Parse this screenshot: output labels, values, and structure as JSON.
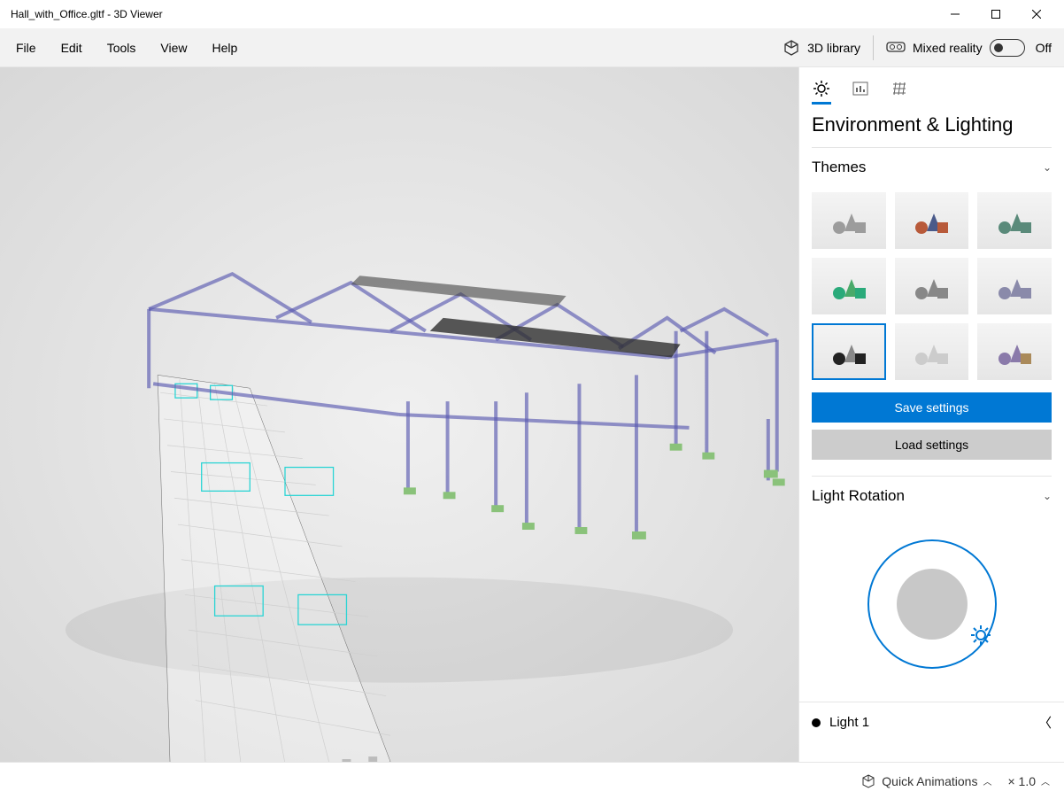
{
  "title": "Hall_with_Office.gltf - 3D Viewer",
  "menu": [
    "File",
    "Edit",
    "Tools",
    "View",
    "Help"
  ],
  "library_label": "3D library",
  "mixed_reality_label": "Mixed reality",
  "mixed_reality_state": "Off",
  "panel": {
    "title": "Environment & Lighting",
    "themes_label": "Themes",
    "save_label": "Save settings",
    "load_label": "Load settings",
    "light_rotation_label": "Light Rotation",
    "light1_label": "Light 1",
    "themes": [
      {
        "sphere": "#9c9c9c",
        "cone": "#9c9c9c",
        "cube": "#9c9c9c",
        "selected": false
      },
      {
        "sphere": "#b85a3a",
        "cone": "#4a5a8a",
        "cube": "#b85a3a",
        "selected": false
      },
      {
        "sphere": "#5a8a7a",
        "cone": "#5a8a7a",
        "cube": "#5a8a7a",
        "selected": false
      },
      {
        "sphere": "#2aaa7a",
        "cone": "#4aaa6a",
        "cube": "#2aaa7a",
        "selected": false
      },
      {
        "sphere": "#888888",
        "cone": "#888888",
        "cube": "#888888",
        "selected": false
      },
      {
        "sphere": "#8a8aaa",
        "cone": "#8a8aaa",
        "cube": "#8a8aaa",
        "selected": false
      },
      {
        "sphere": "#222222",
        "cone": "#888888",
        "cube": "#222222",
        "selected": true
      },
      {
        "sphere": "#cccccc",
        "cone": "#cccccc",
        "cube": "#cccccc",
        "selected": false
      },
      {
        "sphere": "#8a7aaa",
        "cone": "#8a7aaa",
        "cube": "#aa8a5a",
        "selected": false
      }
    ]
  },
  "footer": {
    "quick_anim_label": "Quick Animations",
    "zoom_label": "× 1.0"
  }
}
